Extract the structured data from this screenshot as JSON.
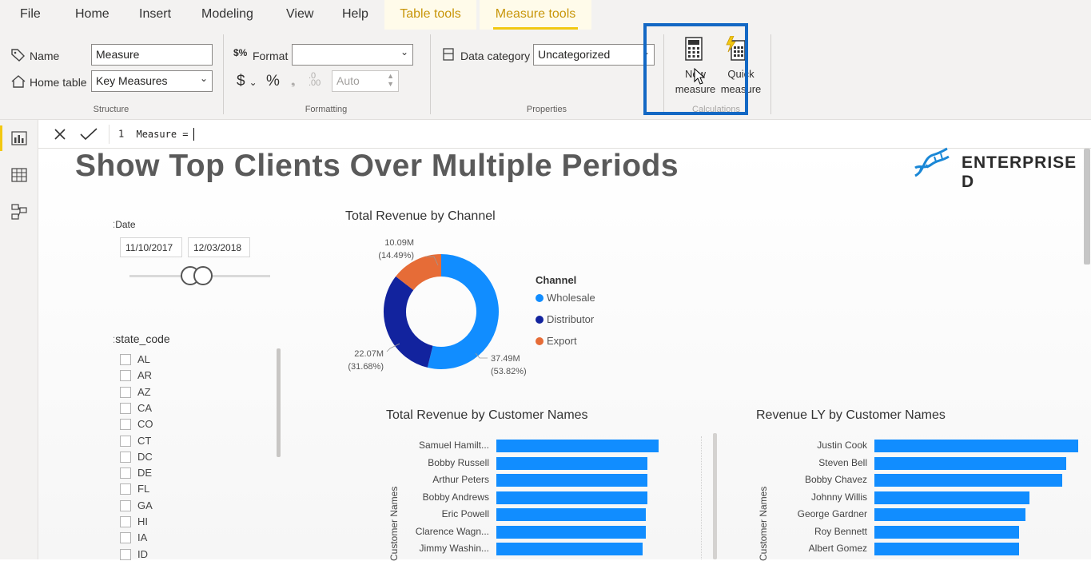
{
  "menu": {
    "items": [
      "File",
      "Home",
      "Insert",
      "Modeling",
      "View",
      "Help"
    ],
    "context_tabs": [
      "Table tools",
      "Measure tools"
    ],
    "active_tab": "Measure tools"
  },
  "ribbon": {
    "structure": {
      "name_label": "Name",
      "name_value": "Measure",
      "home_table_label": "Home table",
      "home_table_value": "Key Measures",
      "group_label": "Structure"
    },
    "formatting": {
      "format_label": "Format",
      "format_value": "",
      "currency_symbol": "$",
      "percent_symbol": "%",
      "decimal_places": "Auto",
      "group_label": "Formatting"
    },
    "properties": {
      "data_category_label": "Data category",
      "data_category_value": "Uncategorized",
      "group_label": "Properties"
    },
    "calculations": {
      "new_measure_line1": "New",
      "new_measure_line2": "measure",
      "quick_measure_line1": "Quick",
      "quick_measure_line2": "measure",
      "group_label": "Calculations"
    }
  },
  "formula_bar": {
    "line_number": "1",
    "text": "Measure ="
  },
  "report": {
    "title": "Show Top Clients Over Multiple Periods",
    "brand": "ENTERPRISE D",
    "date_slicer": {
      "title": "Date",
      "start": "11/10/2017",
      "end": "12/03/2018"
    },
    "state_slicer": {
      "title": "state_code",
      "items": [
        "AL",
        "AR",
        "AZ",
        "CA",
        "CO",
        "CT",
        "DC",
        "DE",
        "FL",
        "GA",
        "HI",
        "IA",
        "ID"
      ]
    },
    "donut": {
      "title": "Total Revenue by Channel",
      "legend_title": "Channel",
      "labels": {
        "export": [
          "10.09M",
          "(14.49%)"
        ],
        "distributor": [
          "22.07M",
          "(31.68%)"
        ],
        "wholesale": [
          "37.49M",
          "(53.82%)"
        ]
      }
    },
    "bar1": {
      "title": "Total Revenue by Customer Names",
      "axis_label": "Customer Names"
    },
    "bar2": {
      "title": "Revenue LY by Customer Names",
      "axis_label": "Customer Names"
    }
  },
  "colors": {
    "wholesale": "#118dff",
    "distributor": "#12239e",
    "export": "#e66c37",
    "accent": "#f2c811",
    "highlight": "#1368c4"
  },
  "chart_data": [
    {
      "type": "pie",
      "title": "Total Revenue by Channel",
      "legend_title": "Channel",
      "categories": [
        "Wholesale",
        "Distributor",
        "Export"
      ],
      "values": [
        37.49,
        22.07,
        10.09
      ],
      "percent": [
        53.82,
        31.68,
        14.49
      ],
      "unit": "M",
      "donut": true
    },
    {
      "type": "bar",
      "orientation": "horizontal",
      "title": "Total Revenue by Customer Names",
      "ylabel": "Customer Names",
      "categories": [
        "Samuel Hamilt...",
        "Bobby Russell",
        "Arthur Peters",
        "Bobby Andrews",
        "Eric Powell",
        "Clarence Wagn...",
        "Jimmy Washin..."
      ],
      "values": [
        1.0,
        0.93,
        0.93,
        0.93,
        0.92,
        0.92,
        0.9
      ],
      "xlim": [
        0,
        1
      ]
    },
    {
      "type": "bar",
      "orientation": "horizontal",
      "title": "Revenue LY by Customer Names",
      "ylabel": "Customer Names",
      "categories": [
        "Justin Cook",
        "Steven Bell",
        "Bobby Chavez",
        "Johnny Willis",
        "George Gardner",
        "Roy Bennett",
        "Albert Gomez"
      ],
      "values": [
        1.0,
        0.94,
        0.92,
        0.76,
        0.74,
        0.71,
        0.71
      ],
      "xlim": [
        0,
        1
      ]
    }
  ]
}
